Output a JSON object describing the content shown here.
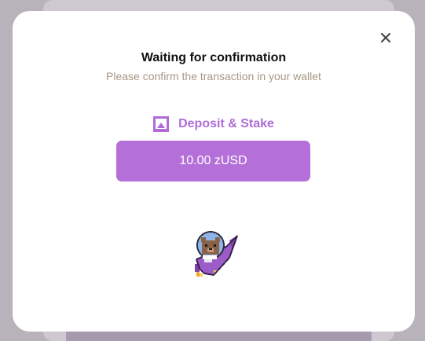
{
  "modal": {
    "title": "Waiting for confirmation",
    "subtitle": "Please confirm the transaction in your wallet",
    "close_icon": "close-icon",
    "action": {
      "icon": "deposit-icon",
      "label": "Deposit & Stake",
      "amount": "10.00 zUSD"
    },
    "illustration": "astronaut-bear-rocket-icon"
  },
  "colors": {
    "accent": "#b470d8",
    "accent_text": "#b06cd8",
    "subtitle": "#a89684",
    "overlay": "#b8b2ba"
  }
}
